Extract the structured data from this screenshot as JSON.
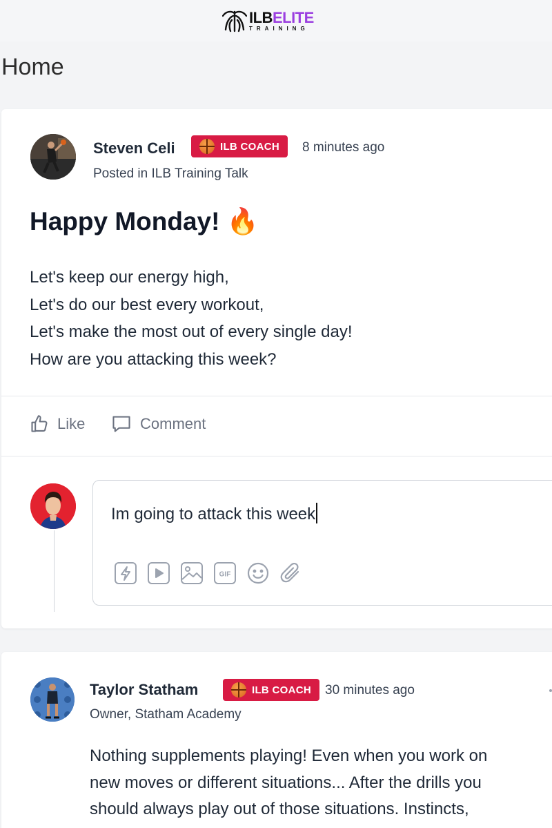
{
  "header": {
    "logo_main_left": "ILB",
    "logo_main_right": "ELITE",
    "logo_sub": "TRAINING"
  },
  "page": {
    "title": "Home"
  },
  "posts": [
    {
      "author": "Steven Celi",
      "badge": "ILB COACH",
      "time": "8 minutes ago",
      "subtitle": "Posted in ILB Training Talk",
      "title": "Happy Monday! 🔥",
      "body": [
        "Let's keep our energy high,",
        "Let's do our best every workout,",
        "Let's make the most out of every single day!",
        "How are you attacking this week?"
      ],
      "actions": {
        "like": "Like",
        "comment": "Comment"
      },
      "comment_draft": "Im going to attack this week"
    },
    {
      "author": "Taylor Statham",
      "badge": "ILB COACH",
      "time": "30 minutes ago",
      "subtitle": "Owner, Statham Academy",
      "body": [
        "Nothing supplements playing! Even when you work on",
        "new moves or different situations... After the drills you",
        "should always play out of those situations. Instincts,"
      ]
    }
  ],
  "composer_tools": [
    "lightning-icon",
    "video-icon",
    "image-icon",
    "gif-icon",
    "emoji-icon",
    "attachment-icon"
  ],
  "composer_tool_labels": {
    "gif": "GIF"
  },
  "colors": {
    "badge": "#d81b44",
    "accent": "#9b3fe0",
    "page_bg": "#f3f4f6"
  }
}
